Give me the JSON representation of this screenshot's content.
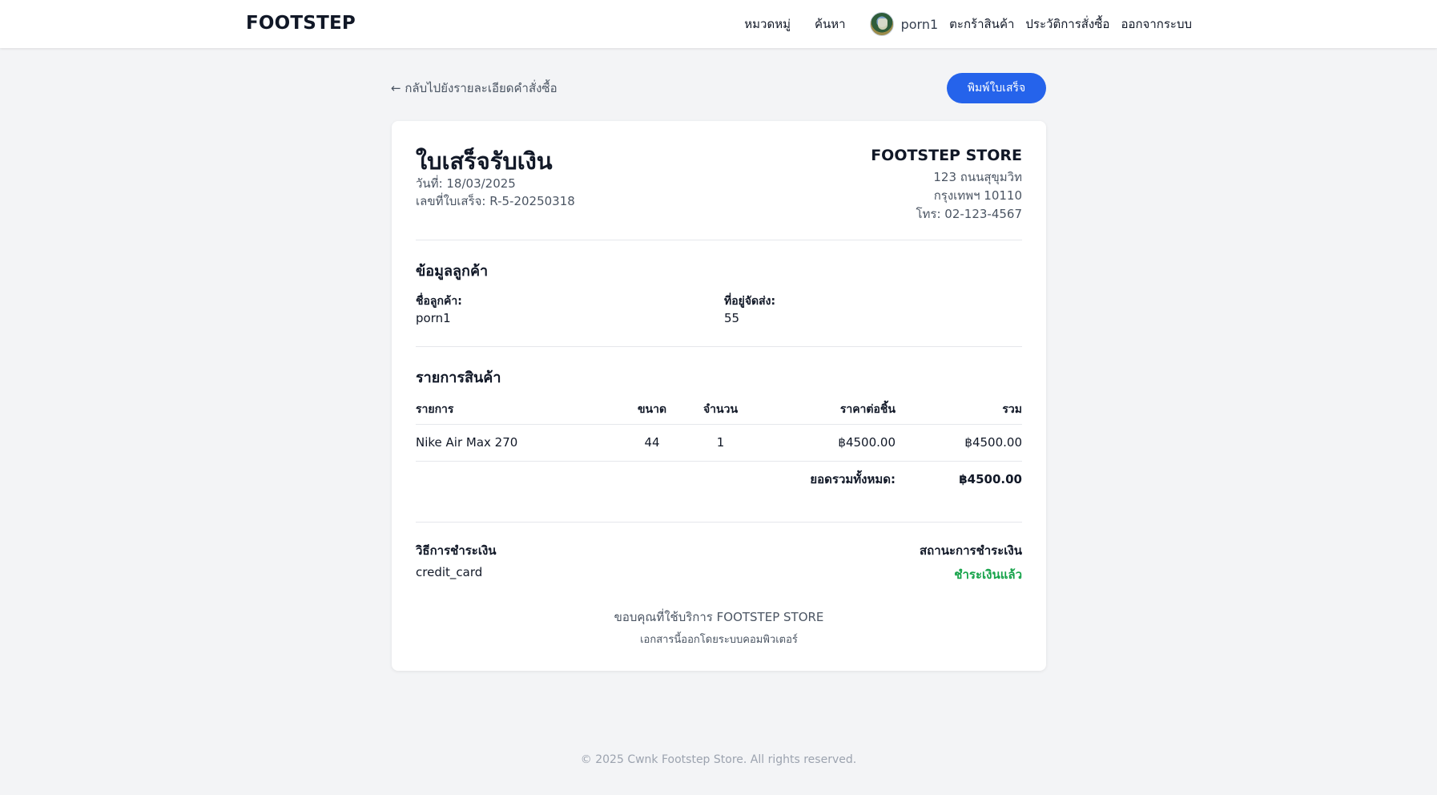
{
  "header": {
    "brand": "FOOTSTEP",
    "nav": {
      "categories": "หมวดหมู่",
      "search": "ค้นหา",
      "username": "porn1",
      "cart": "ตะกร้าสินค้า",
      "order_history": "ประวัติการสั่งซื้อ",
      "logout": "ออกจากระบบ"
    }
  },
  "actions": {
    "back_label": "← กลับไปยังรายละเอียดคำสั่งซื้อ",
    "print_label": "พิมพ์ใบเสร็จ"
  },
  "receipt": {
    "title": "ใบเสร็จรับเงิน",
    "date": "วันที่: 18/03/2025",
    "receipt_no": "เลขที่ใบเสร็จ: R-5-20250318",
    "store": {
      "name": "FOOTSTEP STORE",
      "address1": "123 ถนนสุขุมวิท",
      "address2": "กรุงเทพฯ 10110",
      "phone": "โทร: 02-123-4567"
    },
    "customer": {
      "section_title": "ข้อมูลลูกค้า",
      "name_label": "ชื่อลูกค้า:",
      "name_value": "porn1",
      "shipping_label": "ที่อยู่จัดส่ง:",
      "shipping_value": "55"
    },
    "items": {
      "section_title": "รายการสินค้า",
      "headers": {
        "item": "รายการ",
        "size": "ขนาด",
        "qty": "จำนวน",
        "unit_price": "ราคาต่อชิ้น",
        "total": "รวม"
      },
      "rows": [
        {
          "item": "Nike Air Max 270",
          "size": "44",
          "qty": "1",
          "unit_price": "฿4500.00",
          "total": "฿4500.00"
        }
      ],
      "grand_total_label": "ยอดรวมทั้งหมด:",
      "grand_total_value": "฿4500.00"
    },
    "payment": {
      "method_label": "วิธีการชำระเงิน",
      "method_value": "credit_card",
      "status_label": "สถานะการชำระเงิน",
      "status_value": "ชำระเงินแล้ว",
      "status_color": "#16a34a"
    },
    "thanks": "ขอบคุณที่ใช้บริการ FOOTSTEP STORE",
    "note": "เอกสารนี้ออกโดยระบบคอมพิวเตอร์"
  },
  "footer": {
    "copyright": "© 2025 Cwnk Footstep Store. All rights reserved."
  },
  "colors": {
    "accent": "#2563eb",
    "background": "#f3f4f6",
    "paid": "#16a34a"
  }
}
